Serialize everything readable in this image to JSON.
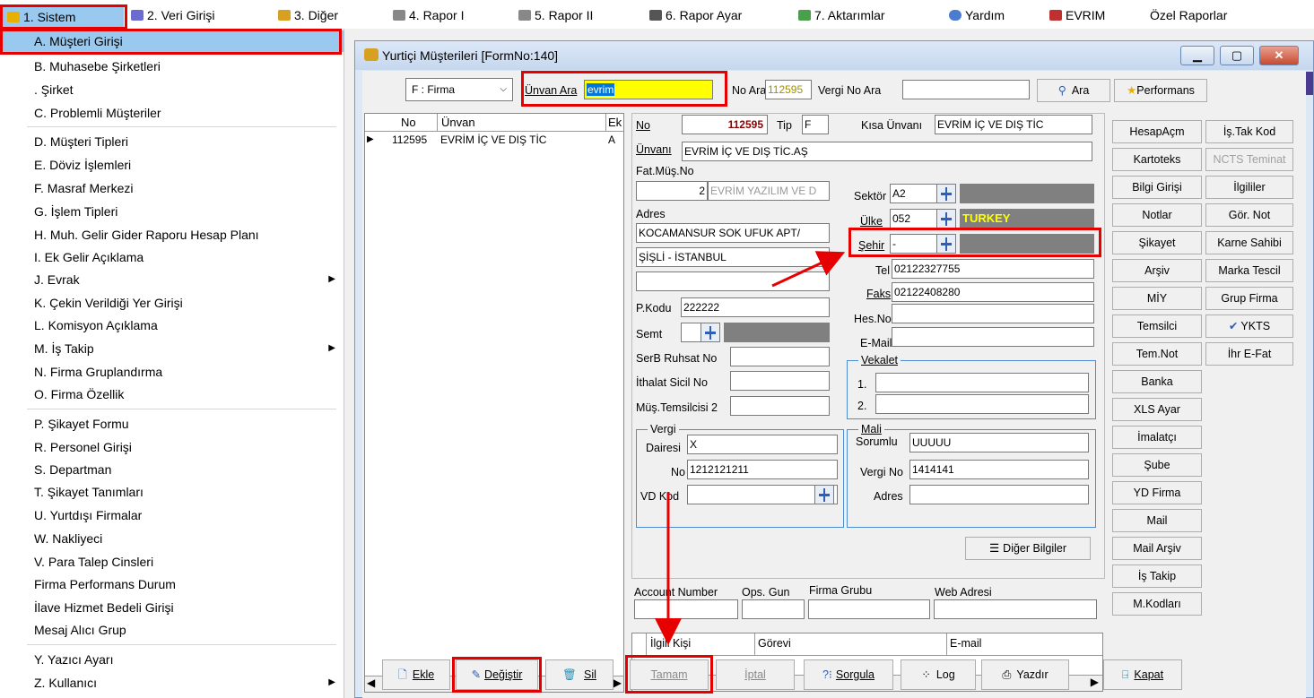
{
  "menubar": {
    "items": [
      {
        "label": "1.  Sistem",
        "icon": "sistem-icon"
      },
      {
        "label": "2.  Veri Girişi",
        "icon": "edit-icon"
      },
      {
        "label": "3.  Diğer",
        "icon": "tools-icon"
      },
      {
        "label": "4.  Rapor I",
        "icon": "printer-icon"
      },
      {
        "label": "5.  Rapor II",
        "icon": "printer-icon"
      },
      {
        "label": "6.  Rapor Ayar",
        "icon": "report-settings-icon"
      },
      {
        "label": "7.  Aktarımlar",
        "icon": "transfer-icon"
      },
      {
        "label": "Yardım",
        "icon": "help-icon"
      },
      {
        "label": "EVRIM",
        "icon": "evrim-icon"
      },
      {
        "label": "Özel Raporlar",
        "icon": ""
      }
    ]
  },
  "dropdown": {
    "items": [
      {
        "label": "A.  Müşteri Girişi",
        "submenu": false
      },
      {
        "label": "B.  Muhasebe Şirketleri",
        "submenu": false
      },
      {
        "label": ".  Şirket",
        "submenu": false
      },
      {
        "label": "C.  Problemli Müşteriler",
        "submenu": false
      },
      {
        "label": "D.  Müşteri Tipleri",
        "submenu": false
      },
      {
        "label": "E.  Döviz İşlemleri",
        "submenu": false
      },
      {
        "label": "F.  Masraf Merkezi",
        "submenu": false
      },
      {
        "label": "G.  İşlem Tipleri",
        "submenu": false
      },
      {
        "label": "H.  Muh. Gelir Gider Raporu Hesap Planı",
        "submenu": false
      },
      {
        "label": "I.  Ek Gelir Açıklama",
        "submenu": false
      },
      {
        "label": "J.  Evrak",
        "submenu": true
      },
      {
        "label": "K.  Çekin Verildiği Yer Girişi",
        "submenu": false
      },
      {
        "label": "L.  Komisyon Açıklama",
        "submenu": false
      },
      {
        "label": "M.  İş Takip",
        "submenu": true
      },
      {
        "label": "N.  Firma Gruplandırma",
        "submenu": false
      },
      {
        "label": "O.  Firma Özellik",
        "submenu": false
      },
      {
        "label": "P.  Şikayet Formu",
        "submenu": false
      },
      {
        "label": "R.  Personel Girişi",
        "submenu": false
      },
      {
        "label": "S.  Departman",
        "submenu": false
      },
      {
        "label": "T.  Şikayet Tanımları",
        "submenu": false
      },
      {
        "label": "U.  Yurtdışı Firmalar",
        "submenu": false
      },
      {
        "label": "W.  Nakliyeci",
        "submenu": false
      },
      {
        "label": "V.  Para Talep Cinsleri",
        "submenu": false
      },
      {
        "label": "Firma Performans Durum",
        "submenu": false
      },
      {
        "label": "İlave Hizmet Bedeli Girişi",
        "submenu": false
      },
      {
        "label": "Mesaj Alıcı Grup",
        "submenu": false
      },
      {
        "label": "Y.  Yazıcı Ayarı",
        "submenu": false
      },
      {
        "label": "Z.  Kullanıcı",
        "submenu": true
      }
    ]
  },
  "form": {
    "title": "Yurtiçi Müşterileri [FormNo:140]",
    "search": {
      "type_value": "F : Firma",
      "unvan_label": "Ünvan Ara",
      "unvan_value": "evrim",
      "no_label": "No Ara",
      "no_value": "112595",
      "vergi_label": "Vergi No Ara",
      "vergi_value": "",
      "ara_label": "Ara",
      "performans_label": "Performans"
    },
    "grid": {
      "headers": [
        "No",
        "Ünvan",
        "Ek"
      ],
      "row": {
        "no": "112595",
        "unvan": "EVRİM İÇ VE DIŞ TİC",
        "ek": "A"
      }
    },
    "detail": {
      "no_label": "No",
      "no_value": "112595",
      "tip_label": "Tip",
      "tip_value": "F",
      "kisa_label": "Kısa Ünvanı",
      "kisa_value": "EVRİM İÇ VE DIŞ TİC",
      "unvan_label": "Ünvanı",
      "unvan_value": "EVRİM İÇ VE DIŞ TİC.AŞ",
      "fatmus_label": "Fat.Müş.No",
      "fatmus_no": "2",
      "fatmus_name": "EVRİM YAZILIM VE D",
      "adres_label": "Adres",
      "adres1": "KOCAMANSUR SOK UFUK APT/",
      "adres2": "ŞİŞLİ - İSTANBUL",
      "adres3": "",
      "pkodu_label": "P.Kodu",
      "pkodu_value": "222222",
      "semt_label": "Semt",
      "semt_value": "",
      "serb_label": "SerB Ruhsat No",
      "ithalat_label": "İthalat Sicil No",
      "mustem_label": "Müş.Temsilcisi 2",
      "sektor_label": "Sektör",
      "sektor_value": "A2",
      "ulke_label": "Ülke",
      "ulke_value": "052",
      "ulke_name": "TURKEY",
      "sehir_label": "Şehir",
      "sehir_value": "-",
      "tel_label": "Tel",
      "tel_value": "02122327755",
      "faks_label": "Faks",
      "faks_value": "02122408280",
      "hesno_label": "Hes.No",
      "email_label": "E-Mail",
      "vekalet_label": "Vekalet",
      "vekalet1_label": "1.",
      "vekalet2_label": "2.",
      "vergi_label": "Vergi",
      "dairesi_label": "Dairesi",
      "dairesi_value": "X",
      "vno_label": "No",
      "vno_value": "1212121211",
      "vdkod_label": "VD Kod",
      "mali_label": "Mali",
      "sorumlu_label": "Sorumlu",
      "sorumlu_value": "UUUUU",
      "vergino_label": "Vergi No",
      "vergino_value": "1414141",
      "madres_label": "Adres",
      "diger_label": "Diğer Bilgiler",
      "account_label": "Account Number",
      "ops_label": "Ops. Gun",
      "grubu_label": "Firma Grubu",
      "web_label": "Web Adresi",
      "contact_headers": [
        "İlgili Kişi",
        "Görevi",
        "E-mail"
      ]
    },
    "right_buttons": {
      "col1": [
        "HesapAçm",
        "Kartoteks",
        "Bilgi Girişi",
        "Notlar",
        "Şikayet",
        "Arşiv",
        "MİY",
        "Temsilci",
        "Tem.Not",
        "Banka",
        "XLS Ayar",
        "İmalatçı",
        "Şube",
        "YD Firma",
        "Mail",
        "Mail Arşiv",
        "İş Takip",
        "M.Kodları"
      ],
      "col2": [
        "İş.Tak Kod",
        "NCTS Teminat",
        "İlgililer",
        "Gör. Not",
        "Karne Sahibi",
        "Marka Tescil",
        "Grup Firma",
        "YKTS",
        "İhr E-Fat"
      ]
    },
    "bottom": {
      "ekle": "Ekle",
      "degistir": "Değiştir",
      "sil": "Sil",
      "tamam": "Tamam",
      "iptal": "İptal",
      "sorgula": "Sorgula",
      "log": "Log",
      "yazdir": "Yazdır",
      "kapat": "Kapat"
    }
  },
  "colors": {
    "highlight": "#99c9ef",
    "annotation": "#e60000",
    "search_bg": "#ffff00",
    "ulke_text": "#ffff00",
    "no_text": "#8b0000"
  }
}
